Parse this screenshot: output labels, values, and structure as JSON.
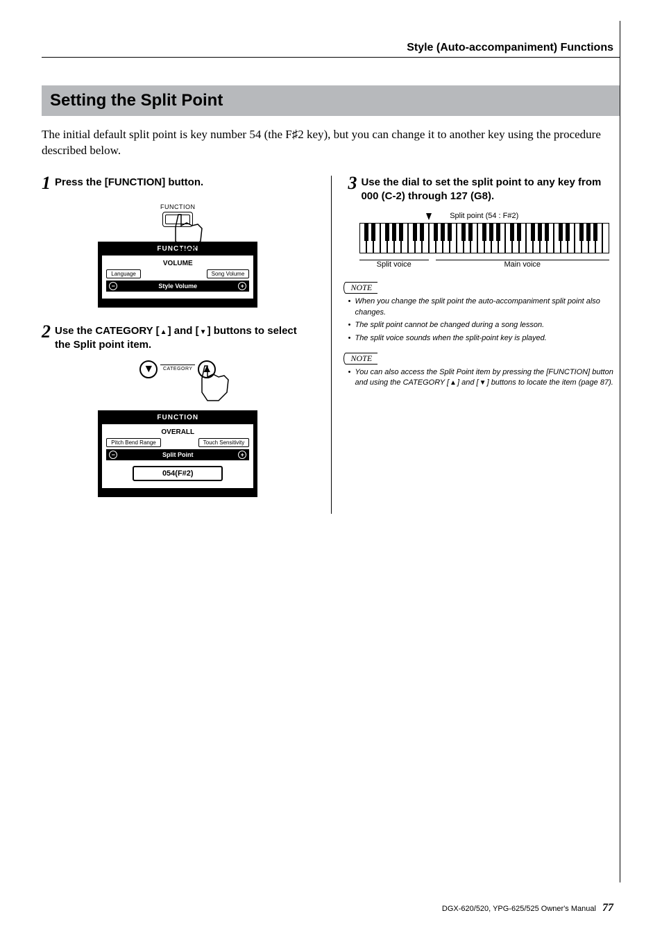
{
  "header": {
    "section": "Style (Auto-accompaniment) Functions"
  },
  "title": "Setting the Split Point",
  "intro": "The initial default split point is key number 54 (the F♯2 key), but you can change it to another key using the procedure described below.",
  "steps": {
    "s1": {
      "num": "1",
      "text": "Press the [FUNCTION] button."
    },
    "s2": {
      "num": "2",
      "text_a": "Use the CATEGORY [",
      "text_b": "] and [",
      "text_c": "] buttons to select the Split point item."
    },
    "s3": {
      "num": "3",
      "text": "Use the dial to set the split point to any key from 000 (C-2) through 127 (G8)."
    }
  },
  "fig1": {
    "btn_label": "FUNCTION",
    "lcd_head": "FUNCTION",
    "lcd_row1": "VOLUME",
    "lcd_left": "Language",
    "lcd_right": "Song Volume",
    "lcd_main": "Style Volume"
  },
  "fig2": {
    "cat_label": "CATEGORY",
    "lcd_head": "FUNCTION",
    "lcd_row1": "OVERALL",
    "lcd_left": "Pitch Bend Range",
    "lcd_right": "Touch Sensitivity",
    "lcd_main": "Split Point",
    "lcd_value": "054(F#2)"
  },
  "fig3": {
    "caption": "Split point (54 : F#2)",
    "label_left": "Split voice",
    "label_right": "Main voice"
  },
  "notes1": {
    "tag": "NOTE",
    "items": [
      "When you change the split point the auto-accompaniment split point also changes.",
      "The split point cannot be changed during a song lesson.",
      "The split voice sounds when the split-point key is played."
    ]
  },
  "notes2": {
    "tag": "NOTE",
    "items_a": "You can also access the Split Point item by pressing the [FUNCTION] button and using the CATEGORY [",
    "items_b": "] and [",
    "items_c": "] buttons to locate the item (page 87)."
  },
  "footer": {
    "manual": "DGX-620/520, YPG-625/525  Owner's Manual",
    "page": "77"
  },
  "icons": {
    "cat_up": "▲",
    "cat_down": "▼",
    "plus": "+",
    "minus": "−",
    "sharp": "♯"
  }
}
